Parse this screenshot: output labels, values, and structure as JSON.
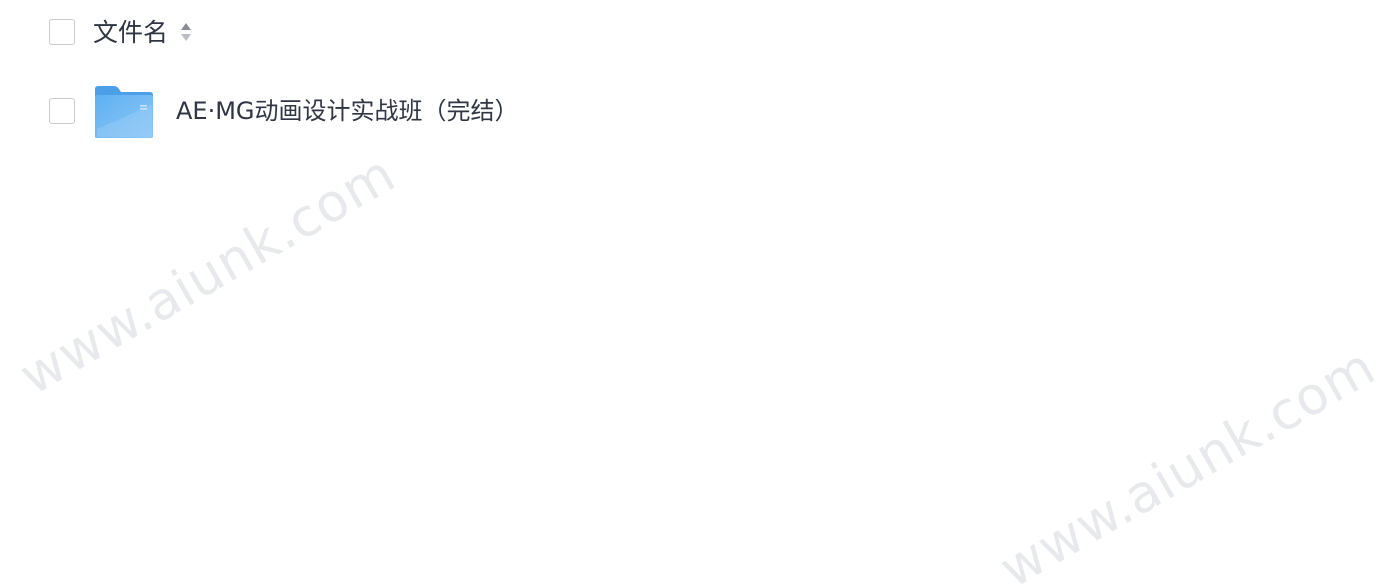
{
  "header": {
    "column_label": "文件名",
    "sort_icon": "sort-icon"
  },
  "files": [
    {
      "name": "AE·MG动画设计实战班（完结）",
      "icon": "folder-icon",
      "selected": false
    }
  ],
  "watermarks": [
    "www.aiunk.com",
    "www.aiunk.com"
  ],
  "colors": {
    "folder_blue": "#5aa9ee",
    "text": "#2f3542",
    "checkbox_border": "#c8cbd2"
  }
}
